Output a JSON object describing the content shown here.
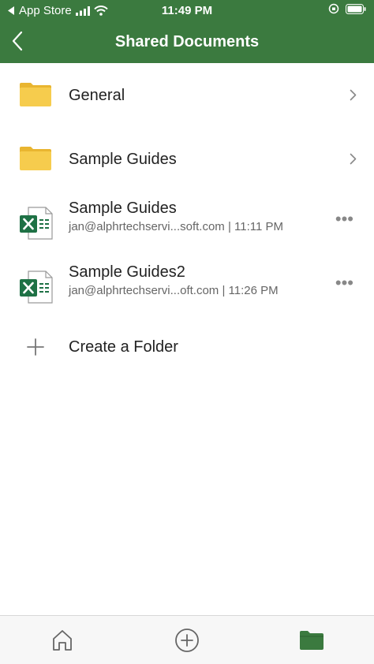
{
  "status_bar": {
    "back_app": "App Store",
    "time": "11:49 PM"
  },
  "header": {
    "title": "Shared Documents",
    "back_icon": "chevron-left-icon"
  },
  "items": [
    {
      "type": "folder",
      "title": "General",
      "icon": "folder-icon"
    },
    {
      "type": "folder",
      "title": "Sample Guides",
      "icon": "folder-icon"
    },
    {
      "type": "file",
      "title": "Sample Guides",
      "subtitle": "jan@alphrtechservi...soft.com | 11:11 PM",
      "icon": "excel-file-icon"
    },
    {
      "type": "file",
      "title": "Sample Guides2",
      "subtitle": "jan@alphrtechservi...oft.com | 11:26 PM",
      "icon": "excel-file-icon"
    }
  ],
  "create_folder": {
    "label": "Create a Folder",
    "icon": "plus-icon"
  },
  "tabs": [
    {
      "name": "home",
      "icon": "home-icon",
      "active": false
    },
    {
      "name": "new",
      "icon": "add-circle-icon",
      "active": false
    },
    {
      "name": "files",
      "icon": "folder-filled-icon",
      "active": true
    }
  ],
  "colors": {
    "header_bg": "#3b7a3f",
    "folder": "#f4c842",
    "excel_green": "#1e7145",
    "active_tab": "#3b7a3f"
  }
}
